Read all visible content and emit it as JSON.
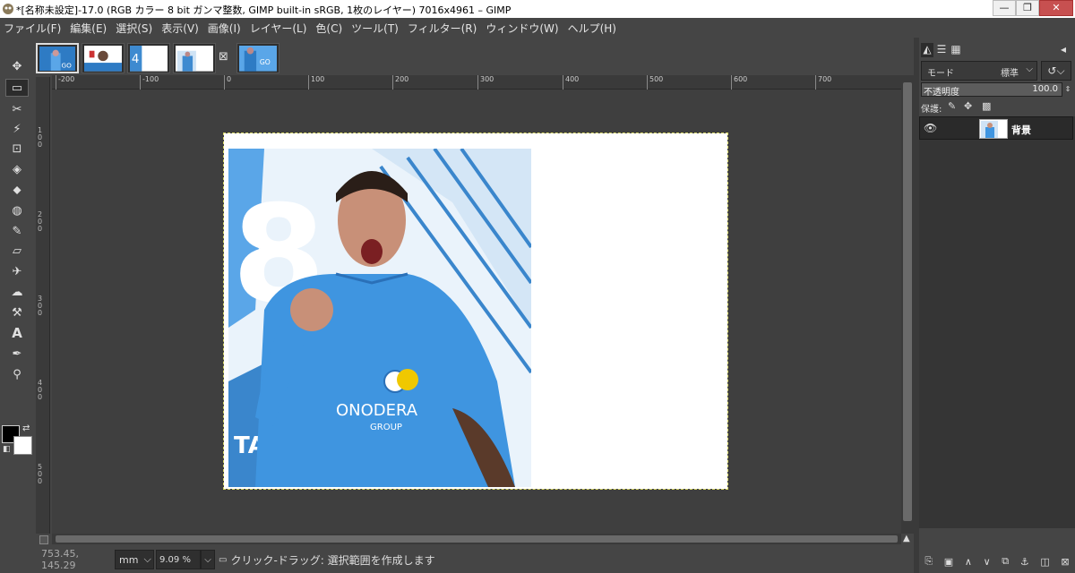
{
  "window": {
    "title": "*[名称未設定]-17.0 (RGB カラー 8 bit ガンマ整数, GIMP built-in sRGB, 1枚のレイヤー) 7016x4961 – GIMP",
    "minimize": "—",
    "maximize": "❐",
    "close": "✕"
  },
  "menu": [
    "ファイル(F)",
    "編集(E)",
    "選択(S)",
    "表示(V)",
    "画像(I)",
    "レイヤー(L)",
    "色(C)",
    "ツール(T)",
    "フィルター(R)",
    "ウィンドウ(W)",
    "ヘルプ(H)"
  ],
  "tools": [
    {
      "name": "move-tool",
      "glyph": "✥"
    },
    {
      "name": "rect-select-tool",
      "glyph": "▭"
    },
    {
      "name": "scissors-select-tool",
      "glyph": "✂"
    },
    {
      "name": "fuzzy-select-tool",
      "glyph": "⚡"
    },
    {
      "name": "crop-tool",
      "glyph": "⊡"
    },
    {
      "name": "unified-transform-tool",
      "glyph": "◈"
    },
    {
      "name": "warp-transform-tool",
      "glyph": "⬥"
    },
    {
      "name": "bucket-fill-tool",
      "glyph": "◍"
    },
    {
      "name": "paintbrush-tool",
      "glyph": "✎"
    },
    {
      "name": "eraser-tool",
      "glyph": "▱"
    },
    {
      "name": "airbrush-tool",
      "glyph": "✈"
    },
    {
      "name": "smudge-tool",
      "glyph": "☁"
    },
    {
      "name": "clone-tool",
      "glyph": "⚒"
    },
    {
      "name": "text-tool",
      "glyph": "A"
    },
    {
      "name": "color-picker-tool",
      "glyph": "✒"
    },
    {
      "name": "zoom-tool",
      "glyph": "⚲"
    }
  ],
  "colors": {
    "foreground": "#000000",
    "background": "#ffffff",
    "selection": "#d9d96a"
  },
  "ruler": {
    "h_labels": [
      "-200",
      "-100",
      "0",
      "100",
      "200",
      "300",
      "400",
      "500",
      "600",
      "700"
    ],
    "v_labels": [
      "100",
      "200",
      "300",
      "400",
      "500"
    ]
  },
  "tabs": [
    "image-1",
    "image-2",
    "image-3",
    "image-4",
    "image-5"
  ],
  "tab_close": "⊠",
  "status": {
    "coords": "753.45, 145.29",
    "unit": "mm",
    "zoom": "9.09 %",
    "message": "クリック-ドラッグ: 選択範囲を作成します"
  },
  "layers_panel": {
    "mode_label": "モード",
    "mode_value": "標準",
    "opacity_label": "不透明度",
    "opacity_value": "100.0",
    "lock_label": "保護:",
    "layer_name": "背景"
  }
}
